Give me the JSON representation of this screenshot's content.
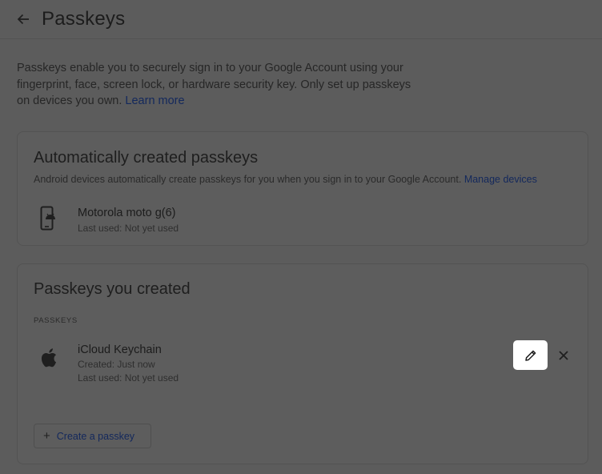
{
  "header": {
    "title": "Passkeys",
    "back_icon": "arrow-back-icon"
  },
  "intro": {
    "text": "Passkeys enable you to securely sign in to your Google Account using your fingerprint, face, screen lock, or hardware security key. Only set up passkeys on devices you own.",
    "link": "Learn more"
  },
  "auto_section": {
    "title": "Automatically created passkeys",
    "description": "Android devices automatically create passkeys for you when you sign in to your Google Account.",
    "link": "Manage devices",
    "items": [
      {
        "name": "Motorola moto g(6)",
        "last_used": "Last used: Not yet used",
        "icon": "android-phone-icon"
      }
    ]
  },
  "created_section": {
    "title": "Passkeys you created",
    "label": "PASSKEYS",
    "items": [
      {
        "name": "iCloud Keychain",
        "created": "Created: Just now",
        "last_used": "Last used: Not yet used",
        "icon": "apple-icon"
      }
    ],
    "edit_icon": "pencil-icon",
    "delete_icon": "close-icon",
    "create_button": "Create a passkey"
  },
  "colors": {
    "background": "#5c5c5c",
    "link": "#13285c",
    "highlight": "#ffffff"
  }
}
